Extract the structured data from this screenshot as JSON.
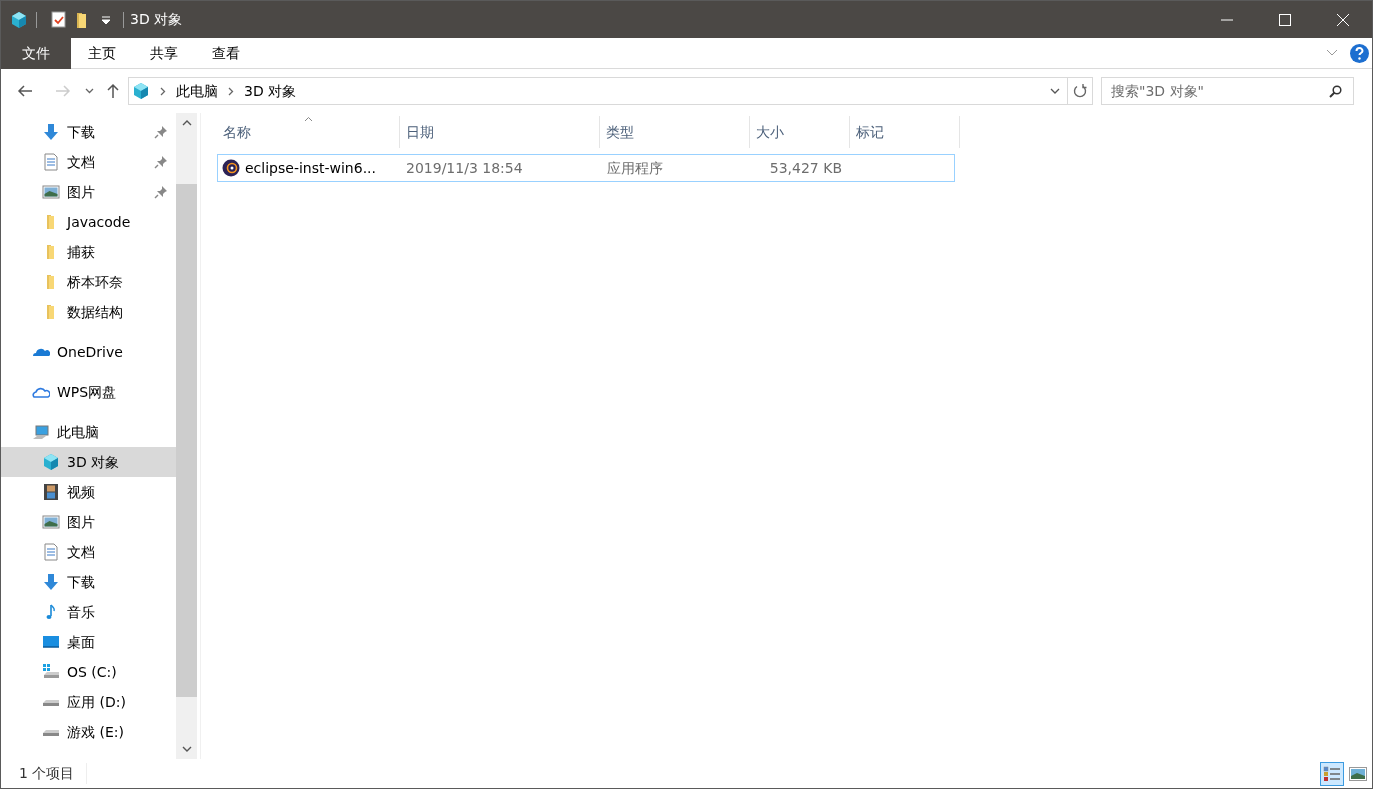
{
  "window": {
    "title": "3D 对象"
  },
  "ribbon": {
    "tabs": [
      {
        "label": "文件",
        "kind": "file"
      },
      {
        "label": "主页",
        "kind": "tab"
      },
      {
        "label": "共享",
        "kind": "tab"
      },
      {
        "label": "查看",
        "kind": "tab"
      }
    ]
  },
  "address": {
    "crumbs": [
      "此电脑",
      "3D 对象"
    ],
    "search_placeholder": "搜索\"3D 对象\""
  },
  "sidebar": {
    "sections": [
      {
        "items": [
          {
            "label": "下载",
            "kind": "download",
            "pinned": true,
            "selected": false
          },
          {
            "label": "文档",
            "kind": "document",
            "pinned": true,
            "selected": false
          },
          {
            "label": "图片",
            "kind": "picture",
            "pinned": true,
            "selected": false
          },
          {
            "label": "Javacode",
            "kind": "folder",
            "pinned": false,
            "selected": false
          },
          {
            "label": "捕获",
            "kind": "folder",
            "pinned": false,
            "selected": false
          },
          {
            "label": "桥本环奈",
            "kind": "folder",
            "pinned": false,
            "selected": false
          },
          {
            "label": "数据结构",
            "kind": "folder",
            "pinned": false,
            "selected": false
          }
        ]
      },
      {
        "items": [
          {
            "label": "OneDrive",
            "kind": "onedrive",
            "pinned": false,
            "selected": false
          }
        ]
      },
      {
        "items": [
          {
            "label": "WPS网盘",
            "kind": "cloud",
            "pinned": false,
            "selected": false
          }
        ]
      },
      {
        "items": [
          {
            "label": "此电脑",
            "kind": "pc",
            "pinned": false,
            "selected": false,
            "children": [
              {
                "label": "3D 对象",
                "kind": "cube",
                "pinned": false,
                "selected": true
              },
              {
                "label": "视频",
                "kind": "video",
                "pinned": false,
                "selected": false
              },
              {
                "label": "图片",
                "kind": "picture",
                "pinned": false,
                "selected": false
              },
              {
                "label": "文档",
                "kind": "document",
                "pinned": false,
                "selected": false
              },
              {
                "label": "下载",
                "kind": "download",
                "pinned": false,
                "selected": false
              },
              {
                "label": "音乐",
                "kind": "music",
                "pinned": false,
                "selected": false
              },
              {
                "label": "桌面",
                "kind": "desktop",
                "pinned": false,
                "selected": false
              },
              {
                "label": "OS (C:)",
                "kind": "osdrive",
                "pinned": false,
                "selected": false
              },
              {
                "label": "应用 (D:)",
                "kind": "drive",
                "pinned": false,
                "selected": false
              },
              {
                "label": "游戏 (E:)",
                "kind": "drive",
                "pinned": false,
                "selected": false
              }
            ]
          }
        ]
      }
    ]
  },
  "table": {
    "columns": [
      "名称",
      "日期",
      "类型",
      "大小",
      "标记"
    ],
    "rows": [
      {
        "name": "eclipse-inst-win6...",
        "date": "2019/11/3 18:54",
        "type": "应用程序",
        "size": "53,427 KB",
        "selected": true
      }
    ]
  },
  "status_bar": {
    "text": "1 个项目",
    "views": [
      {
        "kind": "details",
        "selected": true
      },
      {
        "kind": "thumbnails",
        "selected": false
      }
    ]
  }
}
